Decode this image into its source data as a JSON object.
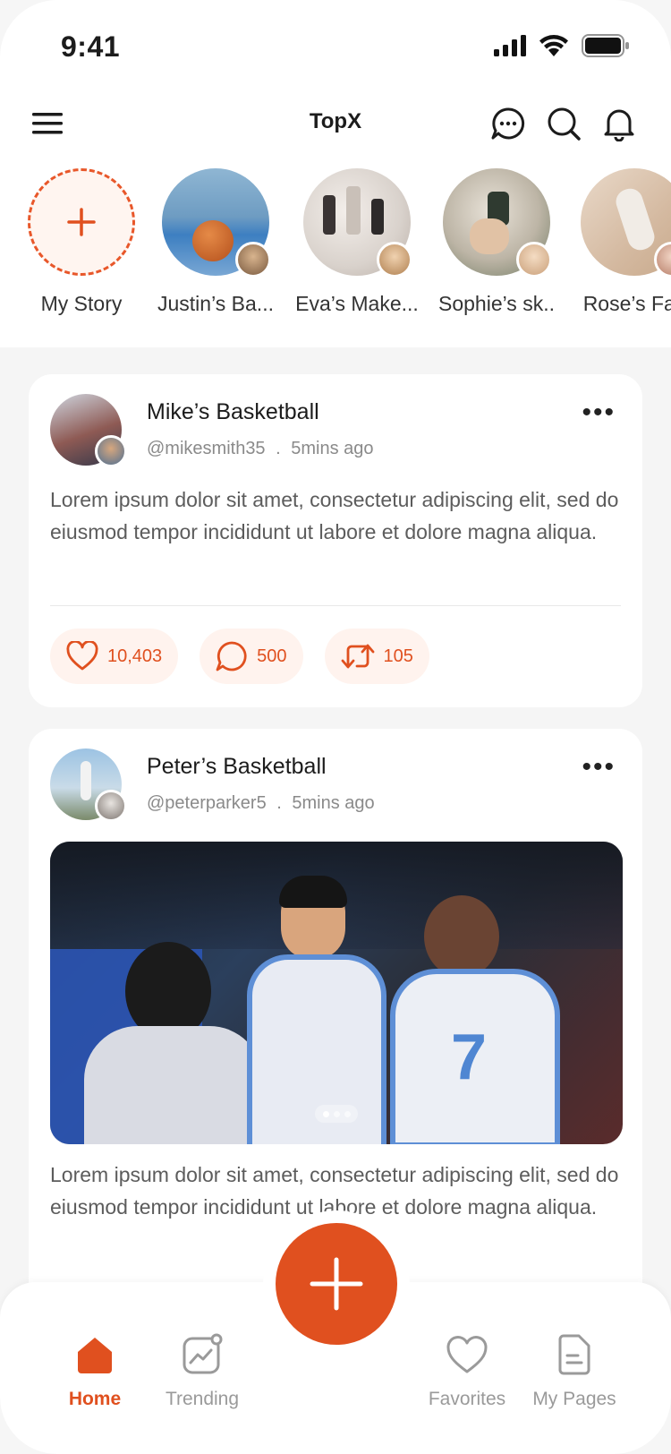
{
  "status_bar": {
    "time": "9:41"
  },
  "header": {
    "title": "TopX"
  },
  "stories": [
    {
      "label": "My Story"
    },
    {
      "label": "Justin’s Ba..."
    },
    {
      "label": "Eva’s Make..."
    },
    {
      "label": "Sophie’s sk.."
    },
    {
      "label": "Rose’s Fas"
    }
  ],
  "posts": [
    {
      "name": "Mike’s Basketball",
      "handle": "@mikesmith35",
      "separator": ".",
      "time": "5mins ago",
      "text": "Lorem ipsum dolor sit amet, consectetur adipiscing elit, sed do eiusmod tempor incididunt ut labore et dolore magna aliqua.",
      "likes": "10,403",
      "comments": "500",
      "reposts": "105"
    },
    {
      "name": "Peter’s Basketball",
      "handle": "@peterparker5",
      "separator": ".",
      "time": "5mins ago",
      "text": "Lorem ipsum dolor sit amet, consectetur adipiscing elit, sed do eiusmod tempor incididunt ut labore et dolore magna aliqua."
    }
  ],
  "bottom_nav": {
    "home": "Home",
    "trending": "Trending",
    "favorites": "Favorites",
    "my_pages": "My Pages"
  },
  "colors": {
    "accent": "#e0501f",
    "accent_light": "#fff3ee"
  }
}
